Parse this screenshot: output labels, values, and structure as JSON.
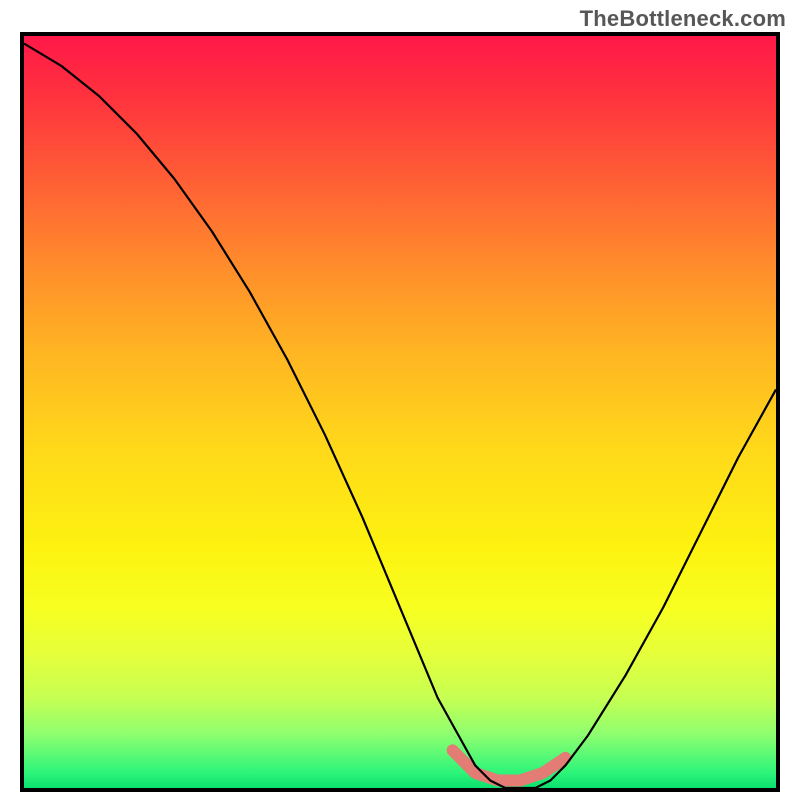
{
  "watermark": "TheBottleneck.com",
  "chart_data": {
    "type": "line",
    "title": "",
    "xlabel": "",
    "ylabel": "",
    "xlim": [
      0,
      100
    ],
    "ylim": [
      0,
      100
    ],
    "curve": {
      "x": [
        0,
        5,
        10,
        15,
        20,
        25,
        30,
        35,
        40,
        45,
        50,
        55,
        60,
        62,
        64,
        66,
        68,
        70,
        72,
        75,
        80,
        85,
        90,
        95,
        100
      ],
      "y": [
        99,
        96,
        92,
        87,
        81,
        74,
        66,
        57,
        47,
        36,
        24,
        12,
        3,
        1,
        0,
        0,
        0,
        1,
        3,
        7,
        15,
        24,
        34,
        44,
        53
      ]
    },
    "highlight_band": {
      "x": [
        57,
        60,
        63,
        66,
        69,
        72
      ],
      "y": [
        5,
        2,
        1,
        1,
        2,
        4
      ]
    },
    "gradient_stops": [
      {
        "pos": 0,
        "color": "#ff1848"
      },
      {
        "pos": 50,
        "color": "#ffd91a"
      },
      {
        "pos": 100,
        "color": "#0be06e"
      }
    ]
  }
}
